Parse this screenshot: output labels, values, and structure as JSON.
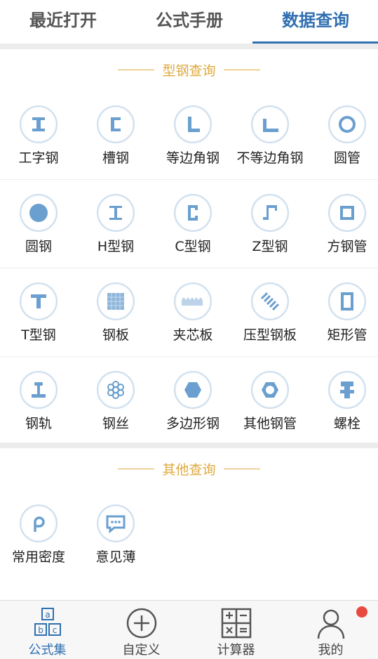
{
  "tabs": [
    {
      "label": "最近打开"
    },
    {
      "label": "公式手册"
    },
    {
      "label": "数据查询"
    }
  ],
  "section_steel": {
    "title": "型钢查询"
  },
  "steel_items": [
    {
      "label": "工字钢",
      "icon": "i-beam-icon"
    },
    {
      "label": "槽钢",
      "icon": "channel-steel-icon"
    },
    {
      "label": "等边角钢",
      "icon": "equal-angle-icon"
    },
    {
      "label": "不等边角钢",
      "icon": "unequal-angle-icon"
    },
    {
      "label": "圆管",
      "icon": "round-pipe-icon"
    },
    {
      "label": "圆钢",
      "icon": "round-bar-icon"
    },
    {
      "label": "H型钢",
      "icon": "h-beam-icon"
    },
    {
      "label": "C型钢",
      "icon": "c-steel-icon"
    },
    {
      "label": "Z型钢",
      "icon": "z-steel-icon"
    },
    {
      "label": "方钢管",
      "icon": "square-tube-icon"
    },
    {
      "label": "T型钢",
      "icon": "t-steel-icon"
    },
    {
      "label": "钢板",
      "icon": "steel-plate-icon"
    },
    {
      "label": "夹芯板",
      "icon": "sandwich-panel-icon"
    },
    {
      "label": "压型钢板",
      "icon": "profiled-sheet-icon"
    },
    {
      "label": "矩形管",
      "icon": "rect-tube-icon"
    },
    {
      "label": "钢轨",
      "icon": "rail-icon"
    },
    {
      "label": "钢丝",
      "icon": "wire-icon"
    },
    {
      "label": "多边形钢",
      "icon": "hexagon-steel-icon"
    },
    {
      "label": "其他钢管",
      "icon": "other-pipe-icon"
    },
    {
      "label": "螺栓",
      "icon": "bolt-icon"
    }
  ],
  "section_other": {
    "title": "其他查询"
  },
  "other_items": [
    {
      "label": "常用密度",
      "icon": "density-icon"
    },
    {
      "label": "意见薄",
      "icon": "feedback-icon"
    }
  ],
  "bottom_nav": [
    {
      "label": "公式集",
      "icon": "formula-set-icon"
    },
    {
      "label": "自定义",
      "icon": "plus-circle-icon"
    },
    {
      "label": "计算器",
      "icon": "calculator-icon"
    },
    {
      "label": "我的",
      "icon": "user-icon"
    }
  ],
  "colors": {
    "accent": "#2f6fb0",
    "section": "#e0a93c",
    "icon_fill": "#6a9fcf",
    "badge": "#e84a3f"
  }
}
